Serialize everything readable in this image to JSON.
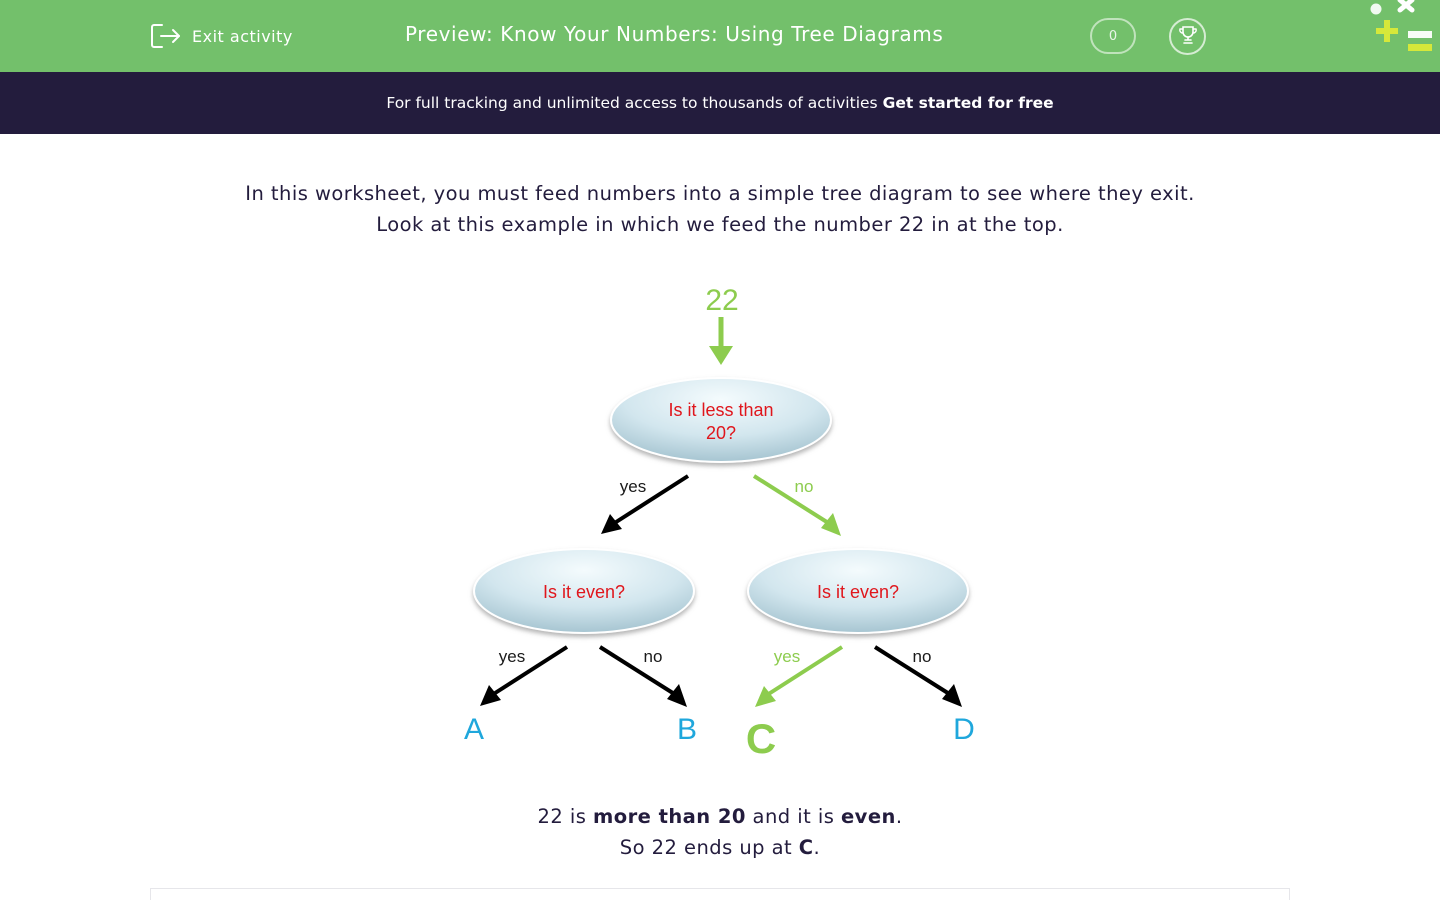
{
  "header": {
    "exit_label": "Exit activity",
    "title": "Preview: Know Your Numbers: Using Tree Diagrams",
    "score": "0"
  },
  "promo": {
    "text": "For full tracking and unlimited access to thousands of activities",
    "cta": "Get started for free"
  },
  "intro": {
    "line1": "In this worksheet, you must feed numbers into a simple tree diagram to see where they exit.",
    "line2": "Look at this example in which we feed the number 22 in at the top."
  },
  "diagram": {
    "input_number": "22",
    "root_question_line1": "Is it less than",
    "root_question_line2": "20?",
    "left_question": "Is it even?",
    "right_question": "Is it even?",
    "root_yes": "yes",
    "root_no": "no",
    "left_yes": "yes",
    "left_no": "no",
    "right_yes": "yes",
    "right_no": "no",
    "outcome_a": "A",
    "outcome_b": "B",
    "outcome_c": "C",
    "outcome_d": "D",
    "highlight_color": "#8dcc4e",
    "outcome_color": "#1fa7dc",
    "question_color": "#e0161c"
  },
  "explain": {
    "l1_a": "22 is ",
    "l1_b": "more than 20",
    "l1_c": " and it is ",
    "l1_d": "even",
    "l1_e": ".",
    "l2_a": "So 22 ends up at ",
    "l2_b": "C",
    "l2_c": "."
  }
}
